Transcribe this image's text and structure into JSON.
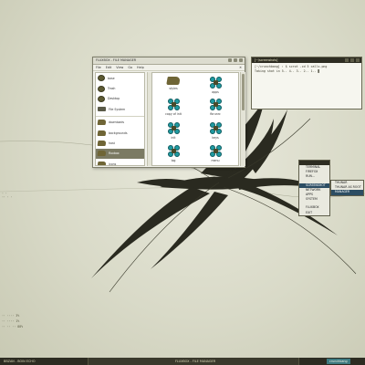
{
  "file_manager": {
    "title": "FLUXBOX - FILE MANAGER",
    "menu": [
      "File",
      "Edit",
      "View",
      "Go",
      "Help"
    ],
    "close_glyph": "✕",
    "sidebar": [
      {
        "label": "base",
        "icon": "home-icon"
      },
      {
        "label": "Trash",
        "icon": "trash-icon"
      },
      {
        "label": "Desktop",
        "icon": "desktop-icon"
      },
      {
        "label": "File System",
        "icon": "drive-icon"
      },
      {
        "label": "downloads",
        "icon": "folder-icon"
      },
      {
        "label": "backgrounds",
        "icon": "folder-icon"
      },
      {
        "label": "host",
        "icon": "folder-icon"
      },
      {
        "label": "fluxbox",
        "icon": "folder-icon",
        "selected": true
      },
      {
        "label": "icons",
        "icon": "folder-icon"
      }
    ],
    "items": [
      {
        "label": "styles",
        "icon": "folder-icon"
      },
      {
        "label": "apps",
        "icon": "file-icon"
      },
      {
        "label": "copy of init",
        "icon": "file-icon"
      },
      {
        "label": "fbrunrc",
        "icon": "file-icon"
      },
      {
        "label": "init",
        "icon": "file-icon"
      },
      {
        "label": "keys",
        "icon": "file-icon"
      },
      {
        "label": "log",
        "icon": "file-icon"
      },
      {
        "label": "menu",
        "icon": "file-icon"
      }
    ]
  },
  "terminal": {
    "title": "[~/screenshots]",
    "lines": [
      "[~/crunchbang] : $ scrot -cd 5 calls.png",
      "Taking shot in 5.. 4.. 3.. 2.. 1.. ▋"
    ]
  },
  "root_menu": {
    "groups": [
      [
        "TERMINAL",
        "FIREFOX",
        "RUN..."
      ],
      [
        "SCREENSHOT",
        "NETWORK",
        "APPS",
        "SYSTEM"
      ],
      [
        "FLUXBOX",
        "EXIT"
      ]
    ],
    "selected": "SCREENSHOT",
    "submenu": [
      "THUNAR",
      "THUNAR AS ROOT",
      "MANAGER"
    ],
    "submenu_selected": "MANAGER"
  },
  "conky": {
    "small": [
      "· ·",
      "·· · ·"
    ],
    "lines": [
      "·· ···· 3%",
      "·· ···· 1%",
      "·· ·· ·· 88%"
    ]
  },
  "taskbar": {
    "left": "BBZAN - BOIN ECHO",
    "center": "FLUXBOX - FILE MANAGER",
    "right_badge": "crunchbang"
  },
  "colors": {
    "accent": "#2c4d63",
    "panel": "#2d2c22",
    "folder": "#6f6536",
    "teal": "#1f9aa1"
  }
}
